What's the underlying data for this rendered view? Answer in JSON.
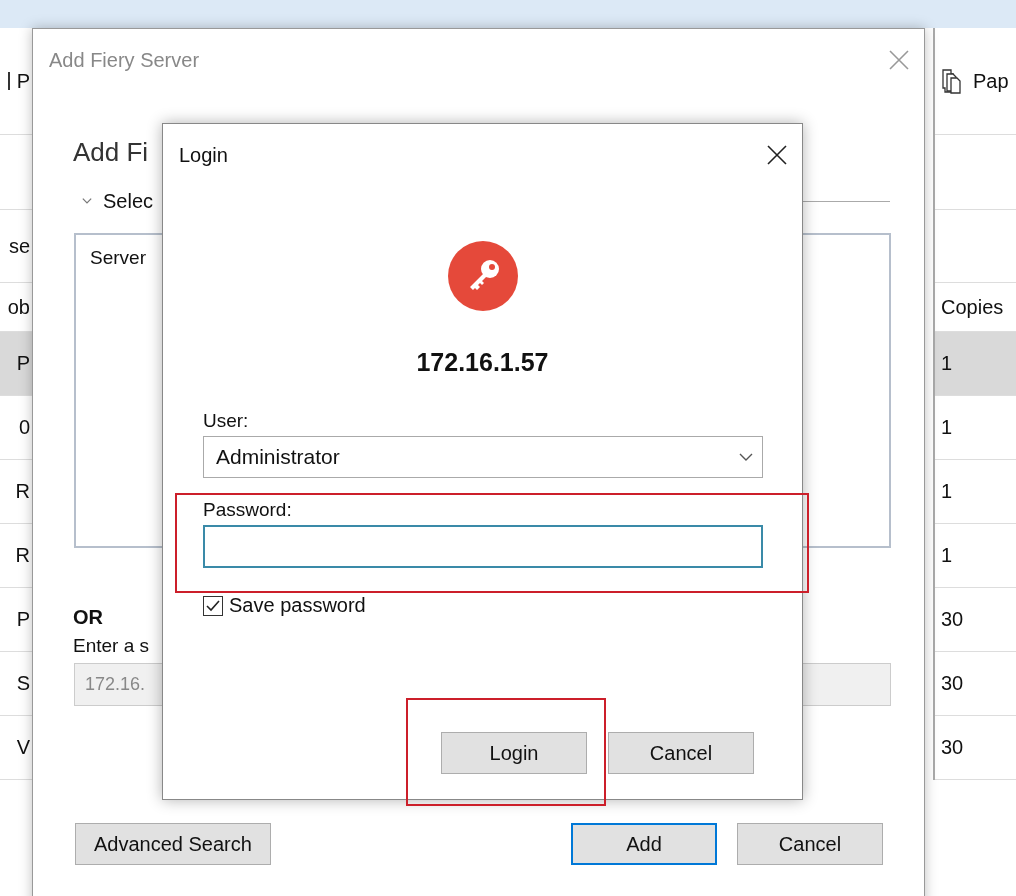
{
  "app": {
    "toolbar_left": "P",
    "toolbar_right": "Pap",
    "label_left": "se",
    "header_left": "ob",
    "header_right": "Copies",
    "rows": [
      {
        "col_1": "P",
        "col_2": "1",
        "selected": true
      },
      {
        "col_1": "0",
        "col_2": "1",
        "selected": false
      },
      {
        "col_1": "R",
        "col_2": "1",
        "selected": false
      },
      {
        "col_1": "R",
        "col_2": "1",
        "selected": false
      },
      {
        "col_1": "P",
        "col_2": "30",
        "selected": false
      },
      {
        "col_1": "S",
        "col_2": "30",
        "selected": false
      },
      {
        "col_1": "V",
        "col_2": "30",
        "selected": false
      }
    ]
  },
  "add_dialog": {
    "title": "Add Fiery Server",
    "heading": "Add Fi",
    "section": {
      "label": "Selec",
      "expanded": true
    },
    "list_header": "Server",
    "or_label": "OR",
    "prompt": "Enter a s",
    "address": {
      "value": "172.16.",
      "disabled": true
    },
    "buttons": [
      {
        "label": "Advanced Search",
        "default": false
      },
      {
        "label": "Add",
        "default": true
      },
      {
        "label": "Cancel",
        "default": false
      }
    ]
  },
  "login_dialog": {
    "title": "Login",
    "server": "172.16.1.57",
    "user": {
      "label": "User:",
      "value": "Administrator"
    },
    "password": {
      "label": "Password:",
      "focused": true
    },
    "save_password": {
      "label": "Save password",
      "checked": true
    },
    "buttons": [
      {
        "label": "Login",
        "default": false
      },
      {
        "label": "Cancel",
        "default": false
      }
    ]
  }
}
